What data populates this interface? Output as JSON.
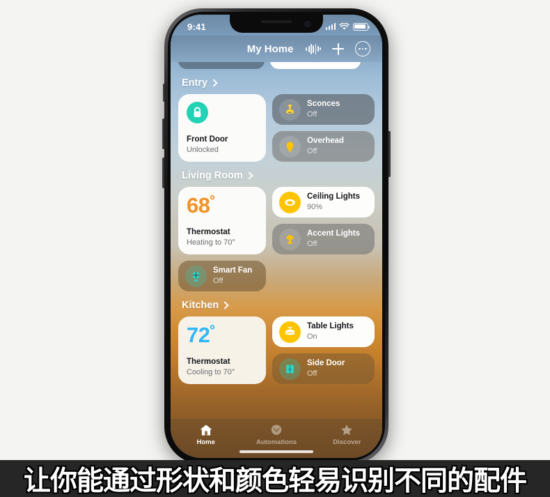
{
  "status_bar": {
    "time": "9:41",
    "cellular_icon": "cellular-bars-icon",
    "wifi_icon": "wifi-icon",
    "battery_icon": "battery-icon"
  },
  "nav_bar": {
    "title": "My Home",
    "siri_icon": "siri-waveform-icon",
    "add_icon": "plus-icon",
    "more_icon": "more-ellipsis-icon"
  },
  "sections": [
    {
      "title": "Entry",
      "chevron_icon": "chevron-right-icon",
      "big_tile": {
        "kind": "lock",
        "icon": "lock-closed-icon",
        "name": "Front Door",
        "status": "Unlocked"
      },
      "small_tiles": [
        {
          "icon": "sconce-lamp-icon",
          "name": "Sconces",
          "status": "Off",
          "state": "off"
        },
        {
          "icon": "bulb-icon",
          "name": "Overhead",
          "status": "Off",
          "state": "off"
        }
      ]
    },
    {
      "title": "Living Room",
      "chevron_icon": "chevron-right-icon",
      "big_tile": {
        "kind": "thermostat",
        "temperature": "68",
        "degree": "º",
        "name": "Thermostat",
        "status": "Heating to 70°",
        "mode": "heating"
      },
      "small_tiles": [
        {
          "icon": "ceiling-light-icon",
          "name": "Ceiling Lights",
          "status": "90%",
          "state": "on"
        },
        {
          "icon": "table-lamp-icon",
          "name": "Accent Lights",
          "status": "Off",
          "state": "off"
        }
      ],
      "wide_tile": {
        "icon": "fan-icon",
        "name": "Smart Fan",
        "status": "Off",
        "state": "off"
      }
    },
    {
      "title": "Kitchen",
      "chevron_icon": "chevron-right-icon",
      "big_tile": {
        "kind": "thermostat",
        "temperature": "72",
        "degree": "º",
        "name": "Thermostat",
        "status": "Cooling to 70°",
        "mode": "cooling"
      },
      "small_tiles": [
        {
          "icon": "chandelier-icon",
          "name": "Table Lights",
          "status": "On",
          "state": "on"
        },
        {
          "icon": "door-icon",
          "name": "Side Door",
          "status": "Off",
          "state": "off"
        }
      ]
    }
  ],
  "tab_bar": {
    "tabs": [
      {
        "label": "Home",
        "icon": "house-icon",
        "active": true
      },
      {
        "label": "Automations",
        "icon": "clock-automation-icon",
        "active": false
      },
      {
        "label": "Discover",
        "icon": "star-icon",
        "active": false
      }
    ]
  },
  "caption": {
    "text": "让你能通过形状和颜色轻易识别不同的配件"
  },
  "colors": {
    "accent_teal": "#23d2b5",
    "accent_yellow": "#ffc400",
    "heat_orange": "#f09227",
    "cool_blue": "#30b8f6",
    "caption_bg": "#262626"
  }
}
